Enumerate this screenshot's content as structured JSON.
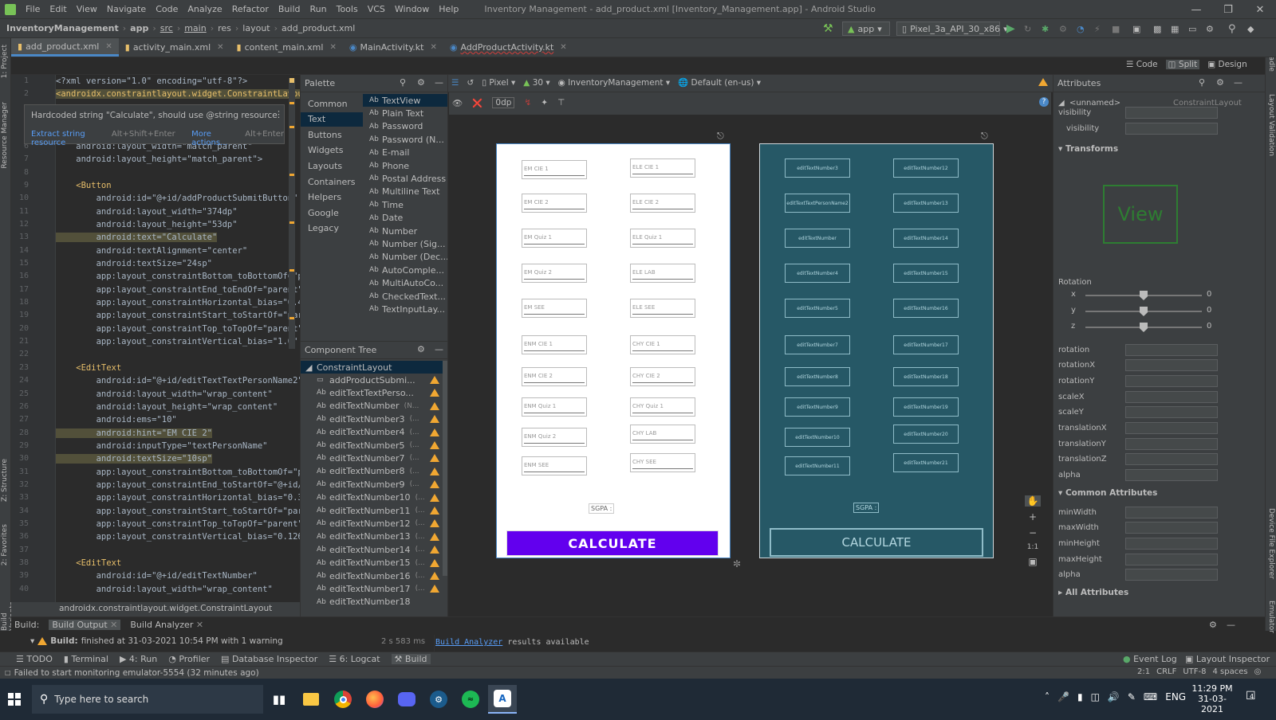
{
  "menubar": {
    "app_icon": "android-studio-icon",
    "items": [
      "File",
      "Edit",
      "View",
      "Navigate",
      "Code",
      "Analyze",
      "Refactor",
      "Build",
      "Run",
      "Tools",
      "VCS",
      "Window",
      "Help"
    ],
    "title": "Inventory Management - add_product.xml [Inventory_Management.app] - Android Studio"
  },
  "breadcrumb": [
    "InventoryManagement",
    "app",
    "src",
    "main",
    "res",
    "layout",
    "add_product.xml"
  ],
  "toolbar": {
    "run_config": "app",
    "device": "Pixel_3a_API_30_x86"
  },
  "tabs": [
    {
      "label": "add_product.xml",
      "active": true
    },
    {
      "label": "activity_main.xml"
    },
    {
      "label": "content_main.xml"
    },
    {
      "label": "MainActivity.kt"
    },
    {
      "label": "AddProductActivity.kt"
    }
  ],
  "left_tools": [
    "1: Project",
    "Resource Manager",
    "Z: Structure",
    "2: Favorites",
    "Build Variants"
  ],
  "right_tools": [
    "Gradle",
    "Layout Validation",
    "Device File Explorer",
    "Emulator"
  ],
  "view_modes": [
    "Code",
    "Split",
    "Design"
  ],
  "editor": {
    "line_numbers": [
      "1",
      "2",
      "",
      "",
      "",
      "6",
      "7",
      "8",
      "9",
      "10",
      "11",
      "12",
      "13",
      "14",
      "15",
      "16",
      "17",
      "18",
      "19",
      "20",
      "21",
      "22",
      "23",
      "24",
      "25",
      "26",
      "27",
      "28",
      "29",
      "30",
      "31",
      "32",
      "33",
      "34",
      "35",
      "36",
      "37",
      "38",
      "39",
      "40"
    ],
    "line1": "<?xml version=\"1.0\" encoding=\"utf-8\"?>",
    "line2": "<androidx.constraintlayout.widget.ConstraintLayout",
    "line6": "    android:layout_width=\"match_parent\"",
    "line7": "    android:layout_height=\"match_parent\">",
    "line9": "    <Button",
    "line10": "        android:id=\"@+id/addProductSubmitButton\"",
    "line11": "        android:layout_width=\"374dp\"",
    "line12": "        android:layout_height=\"53dp\"",
    "line13": "        android:text=\"Calculate\"",
    "line14": "        android:textAlignment=\"center\"",
    "line15": "        android:textSize=\"24sp\"",
    "line16": "        app:layout_constraintBottom_toBottomOf=\"paren",
    "line17": "        app:layout_constraintEnd_toEndOf=\"parent\"",
    "line18": "        app:layout_constraintHorizontal_bias=\"0.466\"",
    "line19": "        app:layout_constraintStart_toStartOf=\"parent\"",
    "line20": "        app:layout_constraintTop_toTopOf=\"parent\"",
    "line21": "        app:layout_constraintVertical_bias=\"1.0\" />",
    "line23": "    <EditText",
    "line24": "        android:id=\"@+id/editTextTextPersonName2\"",
    "line25": "        android:layout_width=\"wrap_content\"",
    "line26": "        android:layout_height=\"wrap_content\"",
    "line27": "        android:ems=\"10\"",
    "line28": "        android:hint=\"EM CIE 2\"",
    "line29": "        android:inputType=\"textPersonName\"",
    "line30": "        android:textSize=\"10sp\"",
    "line31": "        app:layout_constraintBottom_toBottomOf=\"paren",
    "line32": "        app:layout_constraintEnd_toStartOf=\"@+id/edit",
    "line33": "        app:layout_constraintHorizontal_bias=\"0.365",
    "line34": "        app:layout_constraintStart_toStartOf=\"parent",
    "line35": "        app:layout_constraintTop_toTopOf=\"parent\"",
    "line36": "        app:layout_constraintVertical_bias=\"0.126\"",
    "line38": "    <EditText",
    "line39": "        android:id=\"@+id/editTextNumber\"",
    "line40": "        android:layout_width=\"wrap_content\"",
    "status_path": "androidx.constraintlayout.widget.ConstraintLayout"
  },
  "tooltip": {
    "message": "Hardcoded string \"Calculate\", should use @string resource",
    "action1": "Extract string resource",
    "shortcut1": "Alt+Shift+Enter",
    "action2": "More actions...",
    "shortcut2": "Alt+Enter"
  },
  "palette": {
    "title": "Palette",
    "categories": [
      "Common",
      "Text",
      "Buttons",
      "Widgets",
      "Layouts",
      "Containers",
      "Helpers",
      "Google",
      "Legacy"
    ],
    "items": [
      "TextView",
      "Plain Text",
      "Password",
      "Password (N...",
      "E-mail",
      "Phone",
      "Postal Address",
      "Multiline Text",
      "Time",
      "Date",
      "Number",
      "Number (Sig...",
      "Number (Dec...",
      "AutoComple...",
      "MultiAutoCo...",
      "CheckedText...",
      "TextInputLay..."
    ]
  },
  "component_tree": {
    "title": "Component Tree",
    "root": "ConstraintLayout",
    "items": [
      "addProductSubmi...",
      "editTextTextPerso...",
      "editTextNumber",
      "editTextNumber3",
      "editTextNumber4",
      "editTextNumber5",
      "editTextNumber7",
      "editTextNumber8",
      "editTextNumber9",
      "editTextNumber10",
      "editTextNumber11",
      "editTextNumber12",
      "editTextNumber13",
      "editTextNumber14",
      "editTextNumber15",
      "editTextNumber16",
      "editTextNumber17",
      "editTextNumber18"
    ],
    "suffixes": [
      "",
      "",
      "(N...",
      "(...",
      "(...",
      "(...",
      "(...",
      "(...",
      "(...",
      "(...",
      "(...",
      "(...",
      "(...",
      "(...",
      "(...",
      "(...",
      "(...",
      ""
    ]
  },
  "design_toolbar": {
    "device": "Pixel",
    "api": "30",
    "theme": "InventoryManagement",
    "locale": "Default (en-us)",
    "margin": "0dp"
  },
  "preview": {
    "left_hints": [
      "EM CIE 1",
      "EM CIE 2",
      "EM Quiz 1",
      "EM Quiz 2",
      "EM SEE",
      "ENM CIE 1",
      "ENM CIE 2",
      "ENM Quiz 1",
      "ENM Quiz 2",
      "ENM SEE"
    ],
    "right_hints": [
      "ELE CIE 1",
      "ELE CIE 2",
      "ELE Quiz 1",
      "ELE LAB",
      "ELE SEE",
      "CHY CIE 1",
      "CHY CIE 2",
      "CHY Quiz 1",
      "CHY LAB",
      "CHY SEE"
    ],
    "sgpa": "SGPA :",
    "button": "CALCULATE",
    "button_color": "#6200ee"
  },
  "blueprint": {
    "left_ids": [
      "editTextNumber3",
      "editTextTextPersonName2",
      "editTextNumber",
      "editTextNumber4",
      "editTextNumber5",
      "editTextNumber7",
      "editTextNumber8",
      "editTextNumber9",
      "editTextNumber10",
      "editTextNumber11"
    ],
    "right_ids": [
      "editTextNumber12",
      "editTextNumber13",
      "editTextNumber14",
      "editTextNumber15",
      "editTextNumber16",
      "editTextNumber17",
      "editTextNumber18",
      "editTextNumber19",
      "editTextNumber20",
      "editTextNumber21"
    ],
    "sgpa": "SGPA :",
    "button": "CALCULATE"
  },
  "zoom_controls": [
    "+",
    "−",
    "1:1"
  ],
  "attributes": {
    "title": "Attributes",
    "component": "<unnamed>",
    "type": "ConstraintLayout",
    "visibility1": "visibility",
    "visibility2": "visibility",
    "transforms": "Transforms",
    "view_text": "View",
    "rotation_label": "Rotation",
    "axes": [
      "x",
      "y",
      "z"
    ],
    "axis_values": [
      "0",
      "0",
      "0"
    ],
    "transform_fields": [
      "rotation",
      "rotationX",
      "rotationY",
      "scaleX",
      "scaleY",
      "translationX",
      "translationY",
      "translationZ",
      "alpha"
    ],
    "common": "Common Attributes",
    "common_fields": [
      "minWidth",
      "maxWidth",
      "minHeight",
      "maxHeight",
      "alpha"
    ],
    "all": "All Attributes"
  },
  "build": {
    "label": "Build:",
    "tab1": "Build Output",
    "tab2": "Build Analyzer",
    "message_bold": "Build:",
    "message": "finished at 31-03-2021 10:54 PM with 1 warning",
    "duration": "2 s 583 ms",
    "analyzer_link": "Build Analyzer",
    "analyzer_text": "results available"
  },
  "bottom_tools": [
    "TODO",
    "Terminal",
    "4: Run",
    "Profiler",
    "Database Inspector",
    "6: Logcat",
    "Build"
  ],
  "bottom_right": [
    "Event Log",
    "Layout Inspector"
  ],
  "status": {
    "message": "Failed to start monitoring emulator-5554 (32 minutes ago)",
    "position": "2:1",
    "line_sep": "CRLF",
    "encoding": "UTF-8",
    "indent": "4 spaces"
  },
  "taskbar": {
    "search_placeholder": "Type here to search",
    "lang": "ENG",
    "time": "11:29 PM",
    "date": "31-03-2021",
    "notif": "4",
    "apps": [
      "task-view-icon",
      "file-explorer-icon",
      "chrome-icon",
      "firefox-icon",
      "discord-icon",
      "steam-icon",
      "spotify-icon",
      "android-studio-icon"
    ]
  }
}
